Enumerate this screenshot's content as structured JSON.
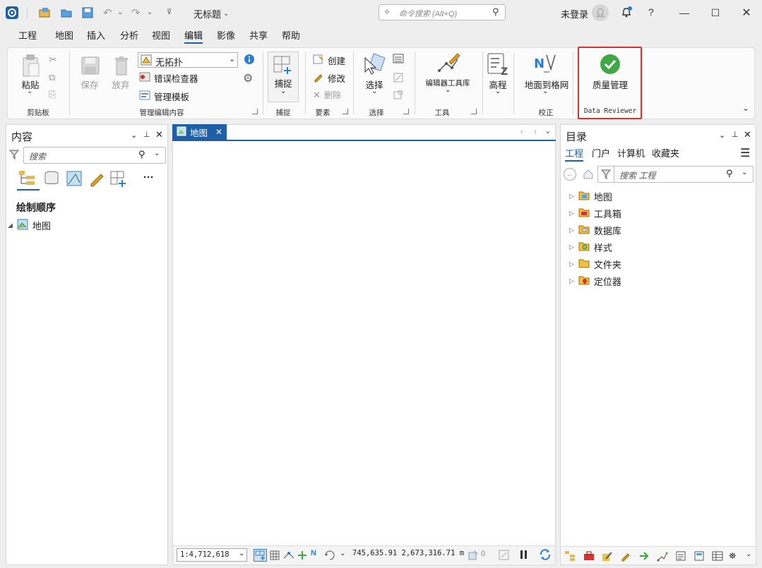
{
  "titlebar": {
    "doc_title": "无标题",
    "search_placeholder": "命令搜索 (Alt+Q)",
    "user": "未登录",
    "help": "?"
  },
  "menu": {
    "items": [
      "工程",
      "地图",
      "插入",
      "分析",
      "视图",
      "编辑",
      "影像",
      "共享",
      "帮助"
    ],
    "active_index": 5
  },
  "ribbon": {
    "clipboard": {
      "paste": "粘贴",
      "group": "剪贴板"
    },
    "manage": {
      "save": "保存",
      "discard": "放弃",
      "topology": "无拓扑",
      "error_inspector": "错误检查器",
      "templates": "管理模板",
      "group": "管理编辑内容"
    },
    "snap": {
      "label": "捕捉",
      "group": "捕捉"
    },
    "features": {
      "create": "创建",
      "modify": "修改",
      "delete": "删除",
      "group": "要素"
    },
    "select": {
      "label": "选择",
      "group": "选择"
    },
    "tools": {
      "label": "编辑器工具库",
      "group": "工具"
    },
    "elevation": {
      "label": "高程"
    },
    "correction": {
      "label": "地面到格网",
      "group": "校正"
    },
    "reviewer": {
      "label": "质量管理",
      "group": "Data Reviewer"
    }
  },
  "left_panel": {
    "title": "内容",
    "search_placeholder": "搜索",
    "section": "绘制顺序",
    "tree": [
      "地图"
    ]
  },
  "map_view": {
    "tab": "地图",
    "scale": "1:4,712,618",
    "coords": "745,635.91 2,673,316.71 m",
    "selected_count": "0"
  },
  "right_panel": {
    "title": "目录",
    "tabs": [
      "工程",
      "门户",
      "计算机",
      "收藏夹"
    ],
    "search_placeholder": "搜索 工程",
    "tree": [
      "地图",
      "工具箱",
      "数据库",
      "样式",
      "文件夹",
      "定位器"
    ]
  },
  "colors": {
    "accent": "#1f5fa8",
    "highlight_border": "#d9312b",
    "reviewer_green": "#3fa845"
  }
}
